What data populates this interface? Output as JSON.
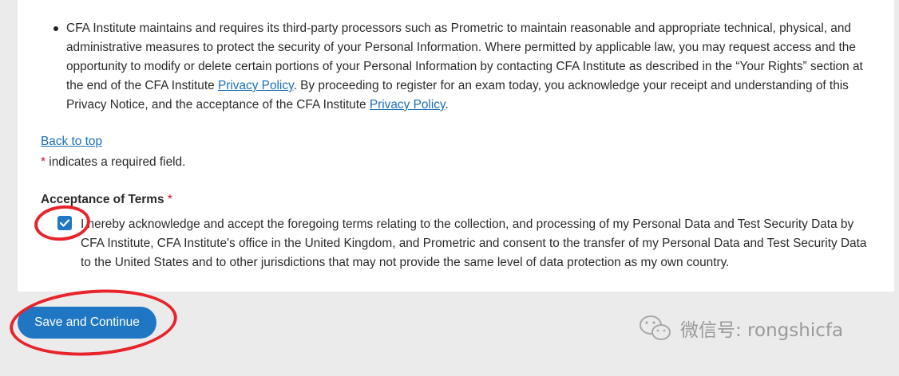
{
  "privacy": {
    "bullet_text_1": "CFA Institute maintains and requires its third-party processors such as Prometric to maintain reasonable and appropriate technical, physical, and administrative measures to protect the security of your Personal Information. Where permitted by applicable law, you may request access and the opportunity to modify or delete certain portions of your Personal Information by contacting CFA Institute as described in the “Your Rights” section at the end of the CFA Institute ",
    "privacy_link_1": "Privacy Policy",
    "bullet_text_2": ". By proceeding to register for an exam today, you acknowledge your receipt and understanding of this Privacy Notice, and the acceptance of the CFA Institute ",
    "privacy_link_2": "Privacy Policy",
    "bullet_text_3": "."
  },
  "back_to_top": "Back to top",
  "required_note": {
    "asterisk": "*",
    "text": " indicates a required field."
  },
  "acceptance": {
    "heading": "Acceptance of Terms",
    "asterisk": "*",
    "checked": true,
    "terms_text": "I hereby acknowledge and accept the foregoing terms relating to the collection, and processing of my Personal Data and Test Security Data by CFA Institute, CFA Institute's office in the United Kingdom, and Prometric and consent to the transfer of my Personal Data and Test Security Data to the United States and to other jurisdictions that may not provide the same level of data protection as my own country."
  },
  "save_button": "Save and Continue",
  "watermark": "微信号: rongshicfa",
  "colors": {
    "accent": "#1f77c4",
    "link": "#1a6fb8",
    "required": "#c8102e",
    "annotation": "#e8242b",
    "page_bg": "#ebebeb",
    "card_bg": "#ffffff"
  }
}
